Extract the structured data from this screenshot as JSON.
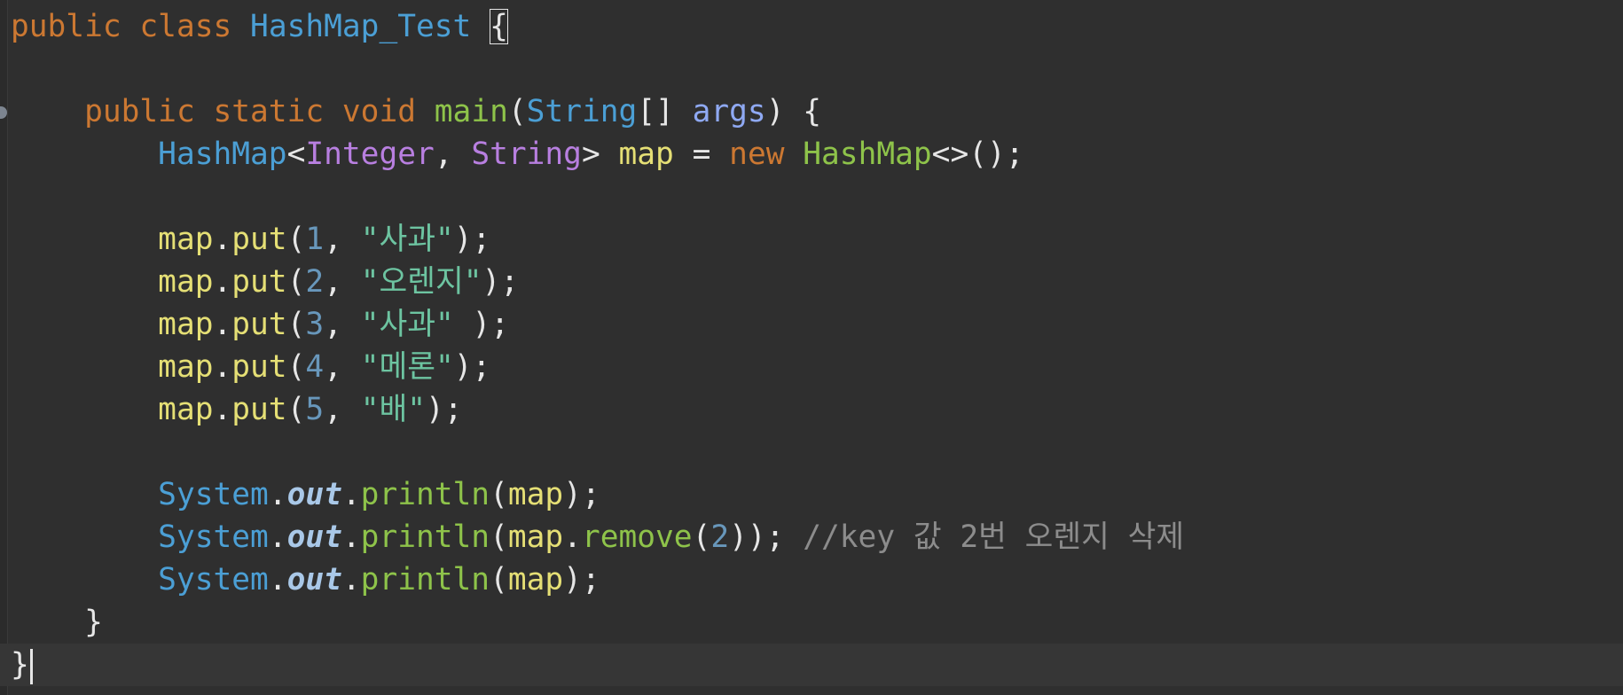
{
  "editor": {
    "lines": [
      {
        "tokens": [
          "public",
          "class",
          "HashMap_Test",
          "{"
        ]
      },
      {
        "tokens": []
      },
      {
        "tokens": [
          "public",
          "static",
          "void",
          "main",
          "(",
          "String",
          "[]",
          "args",
          ")",
          "{"
        ]
      },
      {
        "tokens": [
          "HashMap",
          "<",
          "Integer",
          ",",
          "String",
          ">",
          "map",
          "=",
          "new",
          "HashMap",
          "<>",
          "();"
        ]
      },
      {
        "tokens": []
      },
      {
        "tokens": [
          "map",
          ".",
          "put",
          "(",
          "1",
          ",",
          "\"사과\"",
          ");"
        ]
      },
      {
        "tokens": [
          "map",
          ".",
          "put",
          "(",
          "2",
          ",",
          "\"오렌지\"",
          ");"
        ]
      },
      {
        "tokens": [
          "map",
          ".",
          "put",
          "(",
          "3",
          ",",
          "\"사과\"",
          " );"
        ]
      },
      {
        "tokens": [
          "map",
          ".",
          "put",
          "(",
          "4",
          ",",
          "\"메론\"",
          ");"
        ]
      },
      {
        "tokens": [
          "map",
          ".",
          "put",
          "(",
          "5",
          ",",
          "\"배\"",
          ");"
        ]
      },
      {
        "tokens": []
      },
      {
        "tokens": [
          "System",
          ".",
          "out",
          ".",
          "println",
          "(",
          "map",
          ");"
        ]
      },
      {
        "tokens": [
          "System",
          ".",
          "out",
          ".",
          "println",
          "(",
          "map",
          ".",
          "remove",
          "(",
          "2",
          "));",
          "//key 값 2번 오렌지 삭제"
        ]
      },
      {
        "tokens": [
          "System",
          ".",
          "out",
          ".",
          "println",
          "(",
          "map",
          ");"
        ]
      },
      {
        "tokens": [
          "}"
        ]
      },
      {
        "tokens": [
          "}"
        ]
      }
    ]
  },
  "colors": {
    "background": "#2f2f2f",
    "keyword": "#cc7832",
    "type": "#4b9fd5",
    "generic_type": "#b87fe0",
    "method": "#8ec34a",
    "parameter": "#8fa9f3",
    "variable": "#e5df75",
    "number": "#6897bb",
    "string": "#6dc4a1",
    "static_field": "#a9c8e8",
    "comment": "#8c8c8c",
    "punctuation": "#e6e6e6"
  },
  "icons": {
    "gutter_marker": "breakpoint-marker-icon"
  }
}
